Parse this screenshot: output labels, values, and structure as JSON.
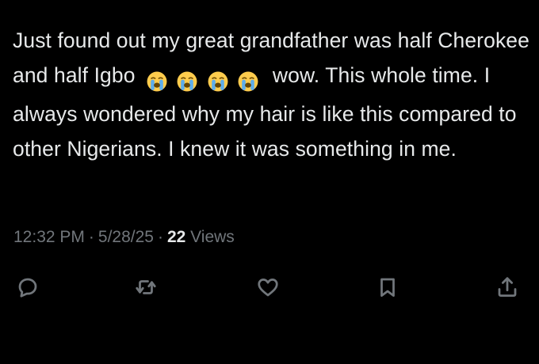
{
  "tweet": {
    "text_part1": "Just found out my great grandfather was half Cherokee and half Igbo",
    "emojis": [
      "loudly-crying-face",
      "loudly-crying-face",
      "loudly-crying-face",
      "loudly-crying-face"
    ],
    "text_part2": "wow. This whole time. I always wondered why my hair is like this compared to other Nigerians. I knew it was something in me."
  },
  "meta": {
    "time": "12:32 PM",
    "date": "5/28/25",
    "separator": "·",
    "views_count": "22",
    "views_label": "Views"
  },
  "actions": {
    "icons": [
      "reply-icon",
      "retweet-icon",
      "like-icon",
      "bookmark-icon",
      "share-icon"
    ]
  },
  "colors": {
    "background": "#000000",
    "text": "#e7e9ea",
    "muted": "#71767b",
    "emoji_face": "#ffcc4d",
    "emoji_tears": "#5dadec"
  }
}
